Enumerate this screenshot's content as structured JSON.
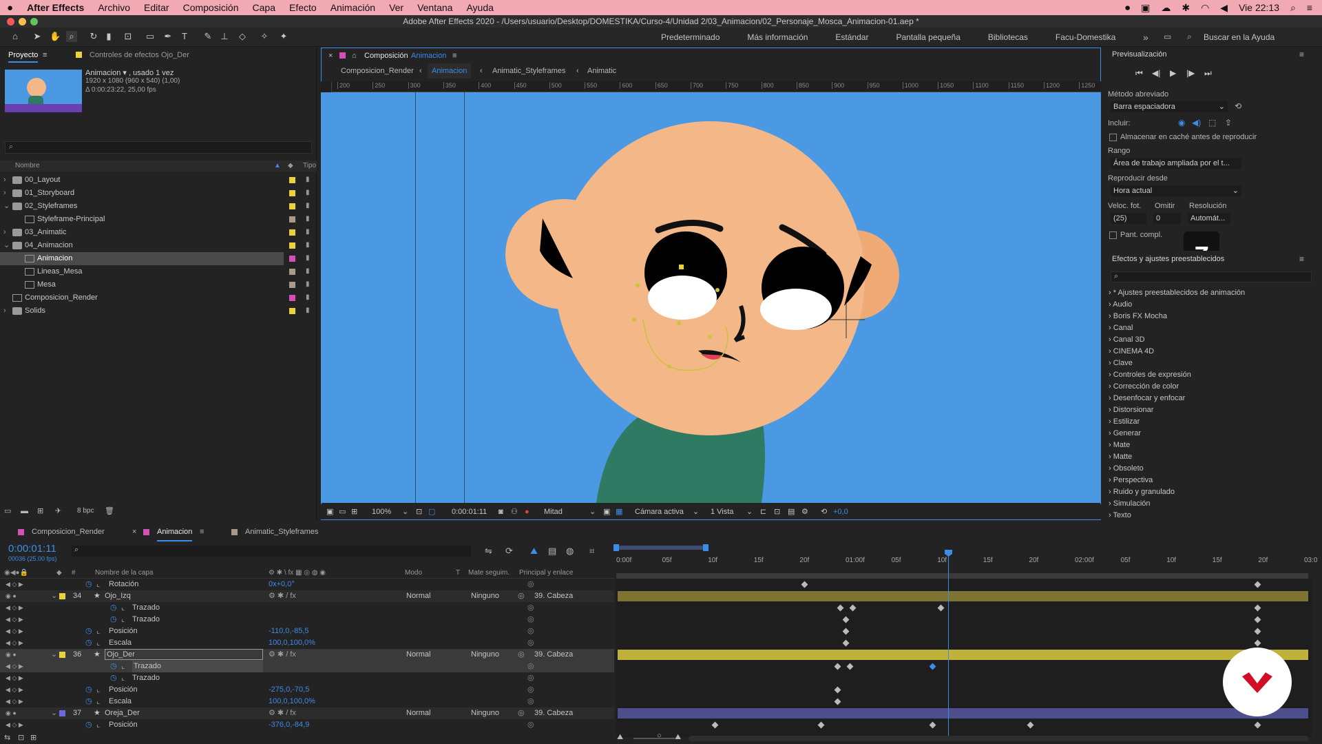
{
  "menubar": {
    "app": "After Effects",
    "items": [
      "Archivo",
      "Editar",
      "Composición",
      "Capa",
      "Efecto",
      "Animación",
      "Ver",
      "Ventana",
      "Ayuda"
    ],
    "clock": "Vie 22:13"
  },
  "window": {
    "title": "Adobe After Effects 2020 - /Users/usuario/Desktop/DOMESTIKA/Curso-4/Unidad 2/03_Animacion/02_Personaje_Mosca_Animacion-01.aep *"
  },
  "toolbar": {
    "workspaces": [
      "Predeterminado",
      "Más información",
      "Estándar",
      "Pantalla pequeña",
      "Bibliotecas",
      "Facu-Domestika"
    ],
    "help_search": "Buscar en la Ayuda"
  },
  "project": {
    "tab_label": "Proyecto",
    "tab2_label": "Controles de efectos Ojo_Der",
    "item_name": "Animacion ▾ , usado 1 vez",
    "item_size": "1920 x 1080  (960 x 540) (1,00)",
    "item_duration": "Δ 0:00:23:22, 25,00 fps",
    "col_name": "Nombre",
    "col_type": "Tipo",
    "items": [
      {
        "label": "00_Layout",
        "indent": 0,
        "type": "folder",
        "arrow": "›",
        "color": "#e9d23a"
      },
      {
        "label": "01_Storyboard",
        "indent": 0,
        "type": "folder",
        "arrow": "›",
        "color": "#e9d23a"
      },
      {
        "label": "02_Styleframes",
        "indent": 0,
        "type": "folder",
        "arrow": "⌄",
        "color": "#e9d23a"
      },
      {
        "label": "Styleframe-Principal",
        "indent": 1,
        "type": "comp",
        "arrow": "",
        "color": "#a89a86"
      },
      {
        "label": "03_Animatic",
        "indent": 0,
        "type": "folder",
        "arrow": "›",
        "color": "#e9d23a"
      },
      {
        "label": "04_Animacion",
        "indent": 0,
        "type": "folder",
        "arrow": "⌄",
        "color": "#e9d23a"
      },
      {
        "label": "Animacion",
        "indent": 1,
        "type": "comp",
        "arrow": "",
        "color": "#d44fb6",
        "selected": true
      },
      {
        "label": "Lineas_Mesa",
        "indent": 1,
        "type": "comp",
        "arrow": "",
        "color": "#a89a86"
      },
      {
        "label": "Mesa",
        "indent": 1,
        "type": "comp",
        "arrow": "",
        "color": "#a89a86"
      },
      {
        "label": "Composicion_Render",
        "indent": 0,
        "type": "comp",
        "arrow": "",
        "color": "#d44fb6"
      },
      {
        "label": "Solids",
        "indent": 0,
        "type": "folder",
        "arrow": "›",
        "color": "#e9d23a"
      }
    ],
    "bpc": "8 bpc"
  },
  "composition": {
    "tab_prefix": "Composición",
    "tab_name": "Animacion",
    "breadcrumbs": [
      "Composicion_Render",
      "Animacion",
      "Animatic_Styleframes",
      "Animatic"
    ],
    "ruler_marks": [
      "200",
      "250",
      "300",
      "350",
      "400",
      "450",
      "500",
      "550",
      "600",
      "650",
      "700",
      "750",
      "800",
      "850",
      "900",
      "950",
      "1000",
      "1050",
      "1100",
      "1150",
      "1200",
      "1250"
    ],
    "zoom": "100%",
    "timecode": "0:00:01:11",
    "resolution": "Mitad",
    "camera": "Cámara activa",
    "views": "1 Vista",
    "exposure": "+0,0"
  },
  "preview": {
    "title": "Previsualización",
    "shortcut_label": "Método abreviado",
    "shortcut_value": "Barra espaciadora",
    "include_label": "Incluir:",
    "cache_label": "Almacenar en caché antes de reproducir",
    "range_label": "Rango",
    "range_value": "Área de trabajo ampliada por el t...",
    "play_from_label": "Reproducir desde",
    "play_from_value": "Hora actual",
    "fps_label": "Veloc. fot.",
    "skip_label": "Omitir",
    "res_label": "Resolución",
    "fps_value": "(25)",
    "skip_value": "0",
    "res_value": "Automát...",
    "fullscreen_label": "Pant. compl.",
    "key_overlay": "Z"
  },
  "effects": {
    "title": "Efectos y ajustes preestablecidos",
    "categories": [
      "* Ajustes preestablecidos de animación",
      "Audio",
      "Boris FX Mocha",
      "Canal",
      "Canal 3D",
      "CINEMA 4D",
      "Clave",
      "Controles de expresión",
      "Corrección de color",
      "Desenfocar y enfocar",
      "Distorsionar",
      "Estilizar",
      "Generar",
      "Mate",
      "Matte",
      "Obsoleto",
      "Perspectiva",
      "Ruido y granulado",
      "Simulación",
      "Texto"
    ]
  },
  "timeline": {
    "tabs": [
      "Composicion_Render",
      "Animacion",
      "Animatic_Styleframes"
    ],
    "timecode": "0:00:01:11",
    "frame_info": "00036 (25.00 fps)",
    "col_layer": "Nombre de la capa",
    "col_mode": "Modo",
    "col_t": "T",
    "col_matte": "Mate seguim.",
    "col_parent": "Principal y enlace",
    "ruler": [
      "0:00f",
      "05f",
      "10f",
      "15f",
      "20f",
      "01:00f",
      "05f",
      "10f",
      "15f",
      "20f",
      "02:00f",
      "05f",
      "10f",
      "15f",
      "20f",
      "03:0"
    ],
    "layers": [
      {
        "kind": "prop",
        "name": "Rotación",
        "value": "0x+0,0°",
        "indent": 1
      },
      {
        "kind": "layer",
        "num": "34",
        "name": "Ojo_Izq",
        "color": "#e9d23a",
        "mode": "Normal",
        "matte": "Ninguno",
        "parent": "39. Cabeza",
        "bar": "#7d7434"
      },
      {
        "kind": "prop",
        "name": "Trazado",
        "value": "",
        "indent": 2
      },
      {
        "kind": "prop",
        "name": "Trazado",
        "value": "",
        "indent": 2
      },
      {
        "kind": "prop",
        "name": "Posición",
        "value": "-110,0,-85,5",
        "indent": 1
      },
      {
        "kind": "prop",
        "name": "Escala",
        "value": "100,0,100,0%",
        "indent": 1
      },
      {
        "kind": "layer",
        "num": "36",
        "name": "Ojo_Der",
        "color": "#e9d23a",
        "mode": "Normal",
        "matte": "Ninguno",
        "parent": "39. Cabeza",
        "bar": "#bfb13a",
        "selected": true
      },
      {
        "kind": "prop",
        "name": "Trazado",
        "value": "",
        "indent": 2,
        "selected": true
      },
      {
        "kind": "prop",
        "name": "Trazado",
        "value": "",
        "indent": 2
      },
      {
        "kind": "prop",
        "name": "Posición",
        "value": "-275,0,-70,5",
        "indent": 1
      },
      {
        "kind": "prop",
        "name": "Escala",
        "value": "100,0,100,0%",
        "indent": 1
      },
      {
        "kind": "layer",
        "num": "37",
        "name": "Oreja_Der",
        "color": "#6a6ad8",
        "mode": "Normal",
        "matte": "Ninguno",
        "parent": "39. Cabeza",
        "bar": "#4d4f8c"
      },
      {
        "kind": "prop",
        "name": "Posición",
        "value": "-376,0,-84,9",
        "indent": 1
      }
    ]
  },
  "colors": {
    "menubar": "#f1a9b3",
    "viewer_bg": "#4a99e2",
    "skin": "#f4b888",
    "shirt": "#2f7a62",
    "accent_blue": "#3d8de6",
    "label_yellow": "#e9d23a",
    "label_pink": "#d44fb6"
  }
}
